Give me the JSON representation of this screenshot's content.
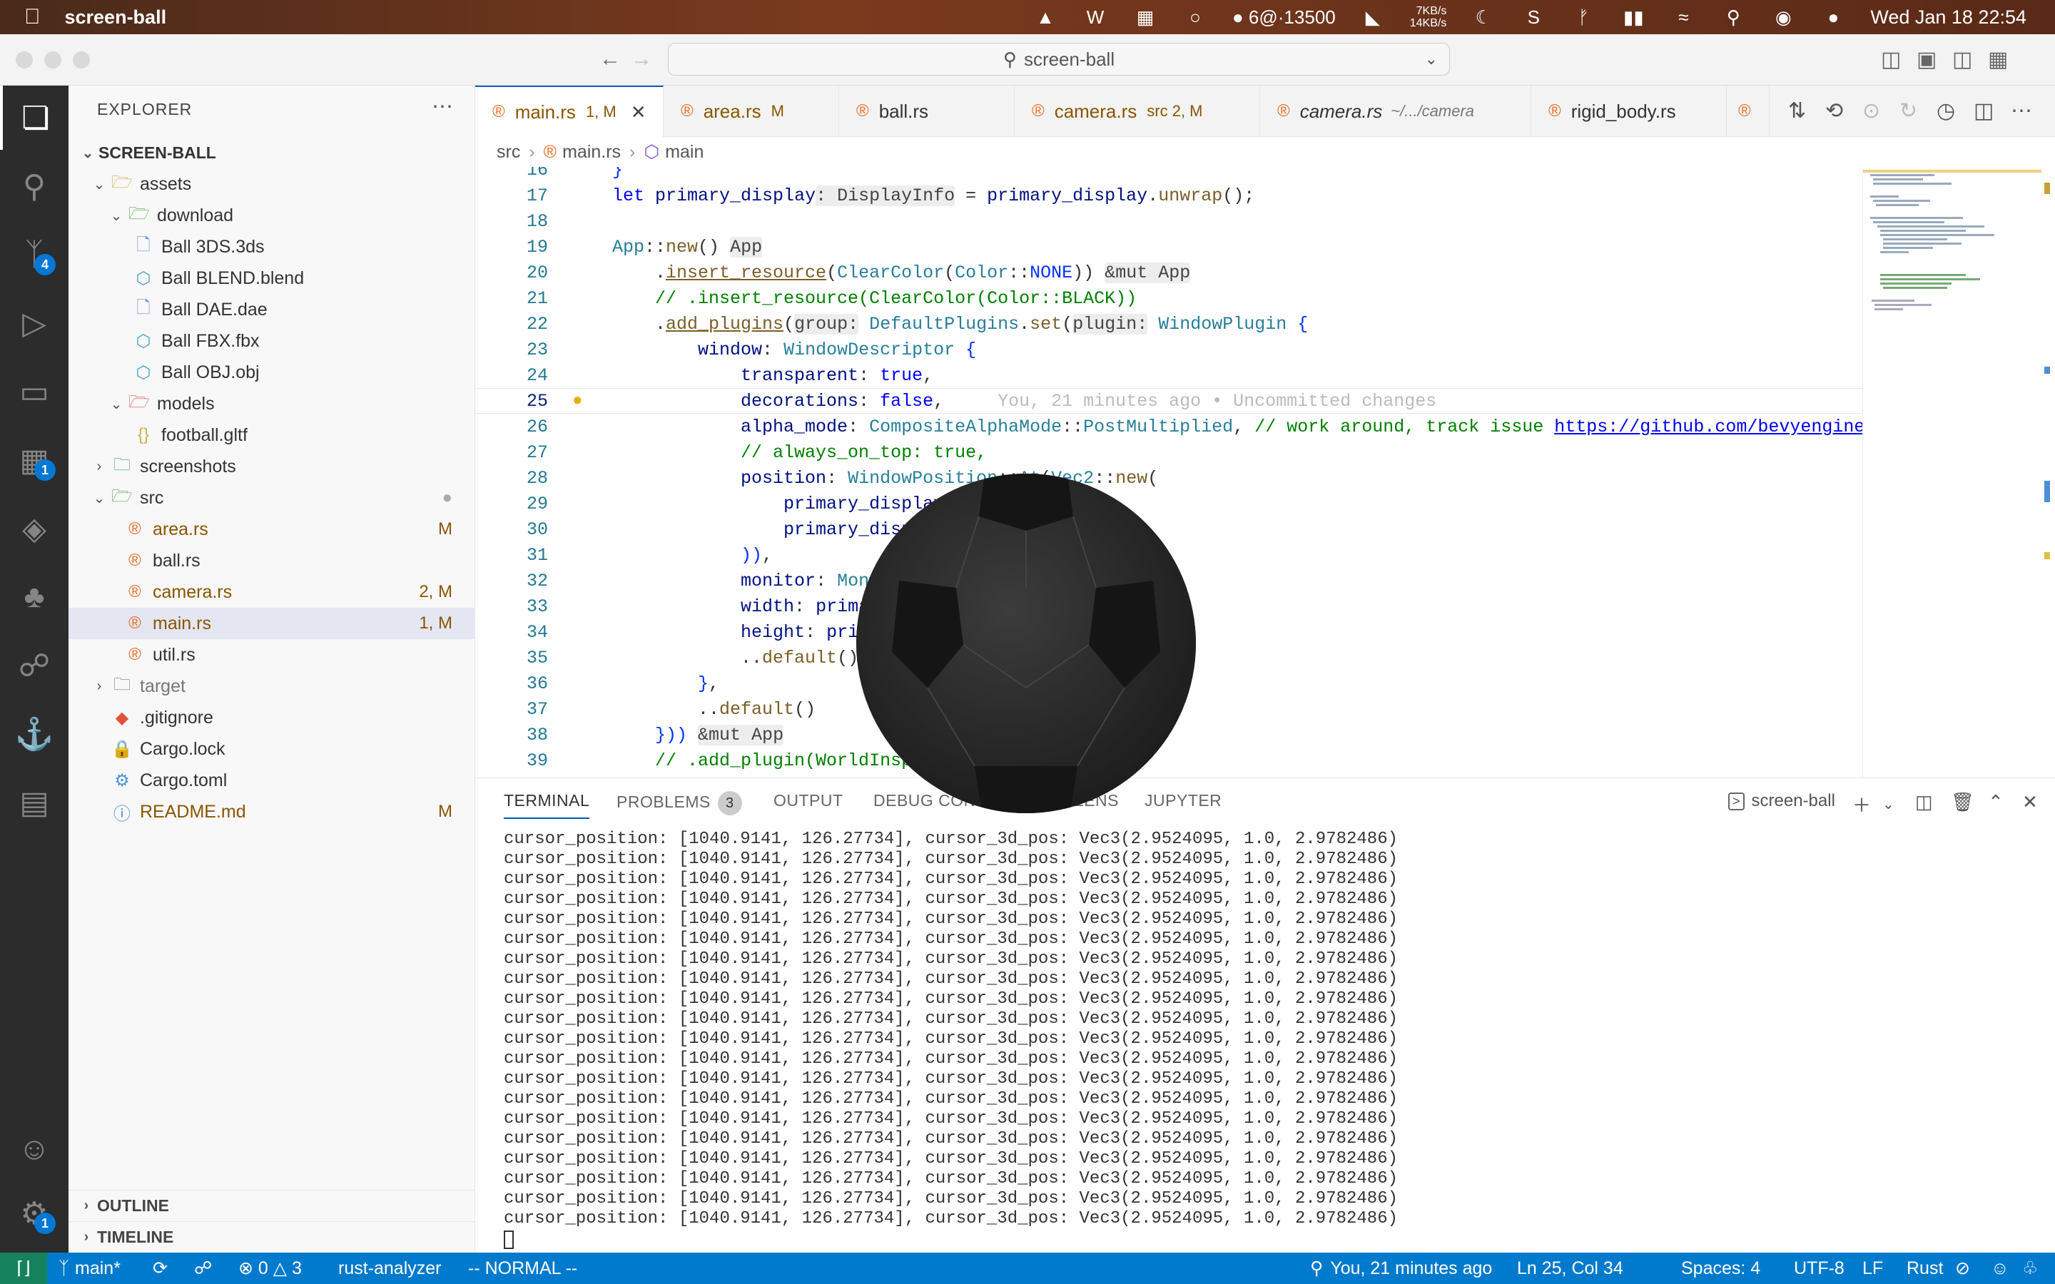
{
  "menubar": {
    "app_name": "screen-ball",
    "mi_label": "6@·13500",
    "net_up": "7KB/s",
    "net_down": "14KB/s",
    "datetime": "Wed Jan 18  22:54"
  },
  "titlebar": {
    "search_label": "screen-ball"
  },
  "activity": {
    "scm_badge": "4",
    "ext_badge": "1",
    "settings_badge": "1"
  },
  "explorer": {
    "title": "EXPLORER",
    "root": "SCREEN-BALL",
    "items": [
      {
        "label": "assets",
        "status": ""
      },
      {
        "label": "download",
        "status": ""
      },
      {
        "label": "Ball 3DS.3ds",
        "status": ""
      },
      {
        "label": "Ball BLEND.blend",
        "status": ""
      },
      {
        "label": "Ball DAE.dae",
        "status": ""
      },
      {
        "label": "Ball FBX.fbx",
        "status": ""
      },
      {
        "label": "Ball OBJ.obj",
        "status": ""
      },
      {
        "label": "models",
        "status": ""
      },
      {
        "label": "football.gltf",
        "status": ""
      },
      {
        "label": "screenshots",
        "status": ""
      },
      {
        "label": "src",
        "status": ""
      },
      {
        "label": "area.rs",
        "status": "M"
      },
      {
        "label": "ball.rs",
        "status": ""
      },
      {
        "label": "camera.rs",
        "status": "2, M"
      },
      {
        "label": "main.rs",
        "status": "1, M"
      },
      {
        "label": "util.rs",
        "status": ""
      },
      {
        "label": "target",
        "status": ""
      },
      {
        "label": ".gitignore",
        "status": ""
      },
      {
        "label": "Cargo.lock",
        "status": ""
      },
      {
        "label": "Cargo.toml",
        "status": ""
      },
      {
        "label": "README.md",
        "status": "M"
      }
    ],
    "outline": "OUTLINE",
    "timeline": "TIMELINE"
  },
  "tabs": [
    {
      "label": "main.rs",
      "meta": "1, M",
      "desc": ""
    },
    {
      "label": "area.rs",
      "meta": "M",
      "desc": ""
    },
    {
      "label": "ball.rs",
      "meta": "",
      "desc": ""
    },
    {
      "label": "camera.rs",
      "meta": "src 2, M",
      "desc": ""
    },
    {
      "label": "camera.rs",
      "meta": "",
      "desc": "~/.../camera"
    },
    {
      "label": "rigid_body.rs",
      "meta": "",
      "desc": ""
    }
  ],
  "breadcrumb": {
    "a": "src",
    "b": "main.rs",
    "c": "main"
  },
  "code": {
    "l16": "16",
    "l17": "17",
    "l18": "18",
    "l19": "19",
    "l20": "20",
    "l21": "21",
    "l22": "22",
    "l23": "23",
    "l24": "24",
    "l25": "25",
    "l26": "26",
    "l27": "27",
    "l28": "28",
    "l29": "29",
    "l30": "30",
    "l31": "31",
    "l32": "32",
    "l33": "33",
    "l34": "34",
    "l35": "35",
    "l36": "36",
    "l37": "37",
    "l38": "38",
    "l39": "39",
    "blame": "You, 21 minutes ago • Uncommitted changes",
    "url": "https://github.com/bevyengine/bevy"
  },
  "panel": {
    "tabs": [
      "TERMINAL",
      "PROBLEMS",
      "OUTPUT",
      "DEBUG CONSOLE",
      "GITLENS",
      "JUPYTER"
    ],
    "problems_count": "3",
    "terminal_name": "screen-ball",
    "line": "cursor_position: [1040.9141, 126.27734], cursor_3d_pos: Vec3(2.9524095, 1.0, 2.9782486)",
    "line_count": 20
  },
  "status": {
    "branch": "main*",
    "errors": "0",
    "warnings": "3",
    "lsp": "rust-analyzer",
    "mode": "-- NORMAL --",
    "blame": "You, 21 minutes ago",
    "position": "Ln 25, Col 34",
    "spaces": "Spaces: 4",
    "encoding": "UTF-8",
    "eol": "LF",
    "language": "Rust"
  },
  "colors": {
    "accent": "#007acc",
    "rust": "#e8702a",
    "modified": "#895503"
  }
}
